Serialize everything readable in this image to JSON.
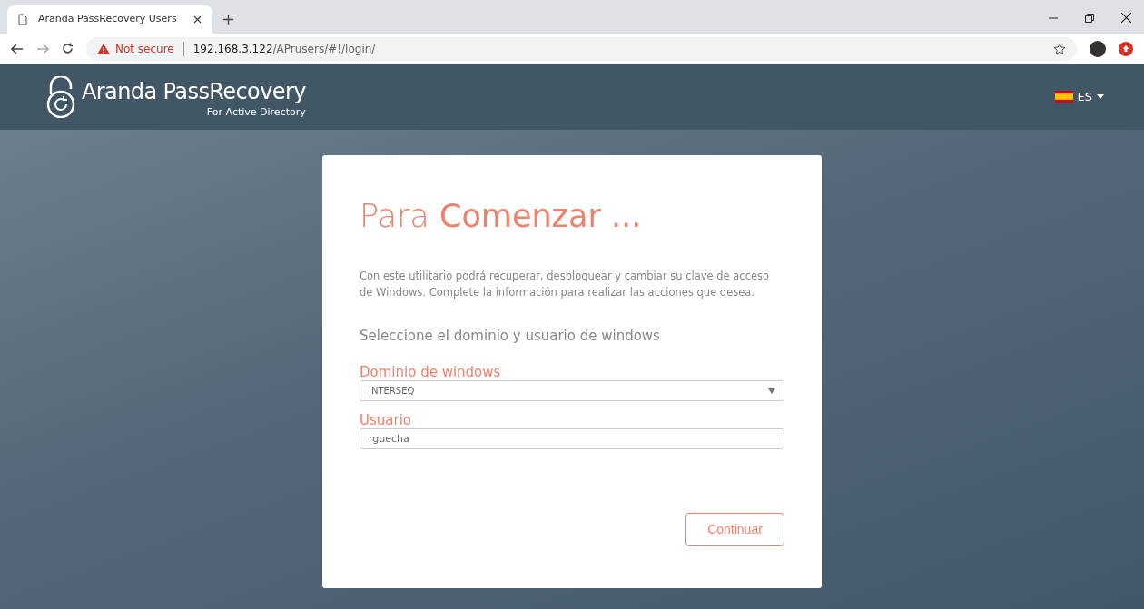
{
  "browser": {
    "tab_title": "Aranda PassRecovery Users",
    "security": "Not secure",
    "url_host": "192.168.3.122",
    "url_path": "/APrusers/#!/login/"
  },
  "header": {
    "brand": "Aranda PassRecovery",
    "brand_sub": "For Active Directory",
    "language": "ES"
  },
  "card": {
    "title": "Para **Comenzar ...**",
    "intro": "Con este utilitario podrá recuperar, desbloquear y cambiar su clave de acceso de Windows. Complete la información para realizar las acciones que desea.",
    "subtitle": "Seleccione el dominio y usuario de windows",
    "fields": [
      {
        "kind": "select",
        "label": "Dominio de windows",
        "value": "INTERSEQ"
      },
      {
        "kind": "text",
        "label": "Usuario",
        "value": "rguecha"
      }
    ],
    "button": "Continuar"
  }
}
